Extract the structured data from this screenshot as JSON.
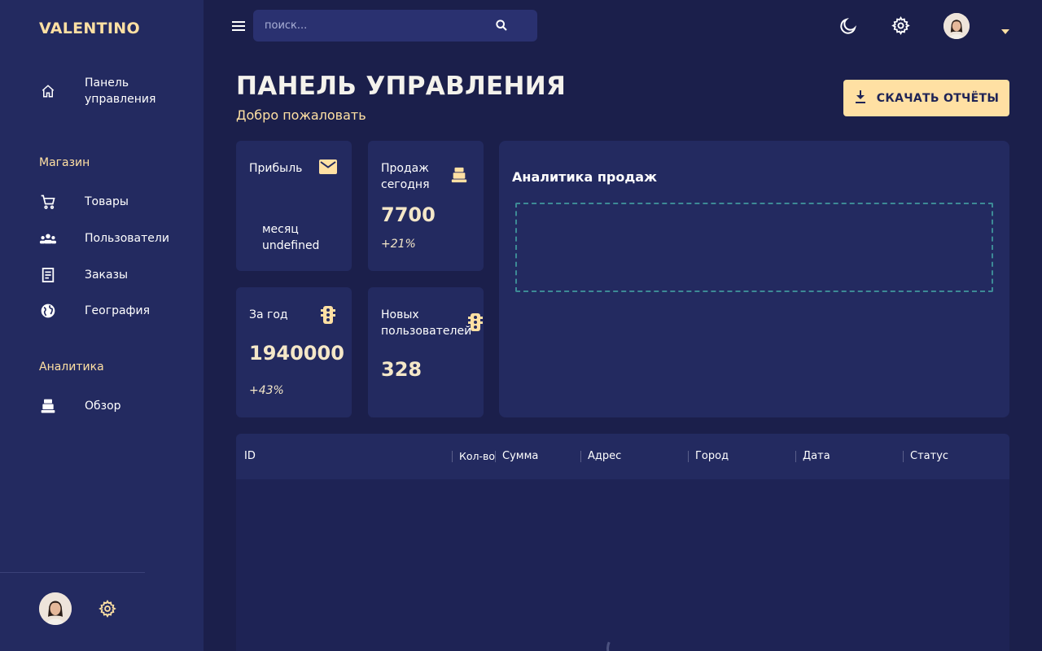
{
  "brand": "VALENTINO",
  "sidebar": {
    "dashboard_label": "Панель управления",
    "section_shop": "Магазин",
    "items": [
      {
        "label": "Товары",
        "icon": "cart-icon"
      },
      {
        "label": "Пользователи",
        "icon": "users-icon"
      },
      {
        "label": "Заказы",
        "icon": "receipt-icon"
      },
      {
        "label": "География",
        "icon": "globe-icon"
      }
    ],
    "section_analytics": "Аналитика",
    "analytics_items": [
      {
        "label": "Обзор",
        "icon": "register-icon"
      }
    ]
  },
  "topbar": {
    "search_placeholder": "поиск..."
  },
  "header": {
    "title": "ПАНЕЛЬ УПРАВЛЕНИЯ",
    "subtitle": "Добро пожаловать",
    "download_label": "СКАЧАТЬ ОТЧЁТЫ"
  },
  "cards": {
    "profit": {
      "title": "Прибыль",
      "extra": "месяц undefined",
      "icon": "mail-icon"
    },
    "sales_today": {
      "title": "Продаж сегодня",
      "value": "7700",
      "delta": "+21%",
      "icon": "register-icon"
    },
    "year": {
      "title": "За год",
      "value": "1940000",
      "delta": "+43%",
      "icon": "traffic-icon"
    },
    "new_users": {
      "title": "Новых пользователей",
      "value": "328",
      "icon": "traffic-icon"
    }
  },
  "analytics": {
    "title": "Аналитика продаж"
  },
  "table": {
    "columns": [
      "ID",
      "Кол-во",
      "Сумма",
      "Адрес",
      "Город",
      "Дата",
      "Статус"
    ]
  },
  "colors": {
    "background": "#1b1f4b",
    "panel": "#232a60",
    "accent": "#ffe0a3"
  }
}
